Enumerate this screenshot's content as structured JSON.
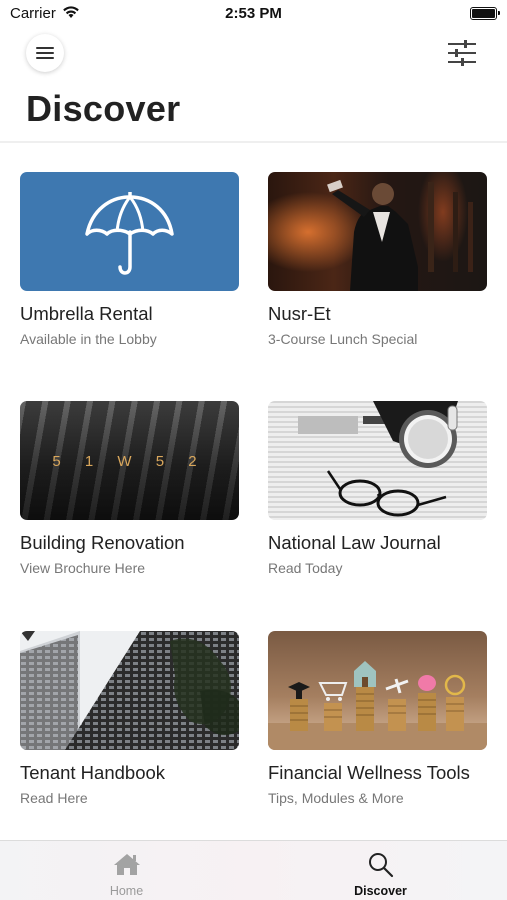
{
  "status_bar": {
    "carrier": "Carrier",
    "time": "2:53 PM"
  },
  "header": {
    "title": "Discover",
    "menu_icon": "hamburger-icon",
    "filter_icon": "sliders-icon"
  },
  "cards": [
    {
      "title": "Umbrella Rental",
      "subtitle": "Available in the Lobby",
      "image": "umbrella-icon",
      "accent": "#3e78b0"
    },
    {
      "title": "Nusr-Et",
      "subtitle": "3-Course Lunch Special",
      "image": "restaurant-photo"
    },
    {
      "title": "Building Renovation",
      "subtitle": "View Brochure Here",
      "image": "building-brochure-photo",
      "brochure_text": "5 1 W 5 2"
    },
    {
      "title": "National Law Journal",
      "subtitle": "Read Today",
      "image": "newspaper-photo"
    },
    {
      "title": "Tenant Handbook",
      "subtitle": "Read Here",
      "image": "skyscraper-photo"
    },
    {
      "title": "Financial Wellness Tools",
      "subtitle": "Tips, Modules & More",
      "image": "coins-photo"
    }
  ],
  "tab_bar": {
    "tabs": [
      {
        "label": "Home",
        "icon": "home-icon",
        "selected": false
      },
      {
        "label": "Discover",
        "icon": "search-icon",
        "selected": true
      }
    ]
  }
}
